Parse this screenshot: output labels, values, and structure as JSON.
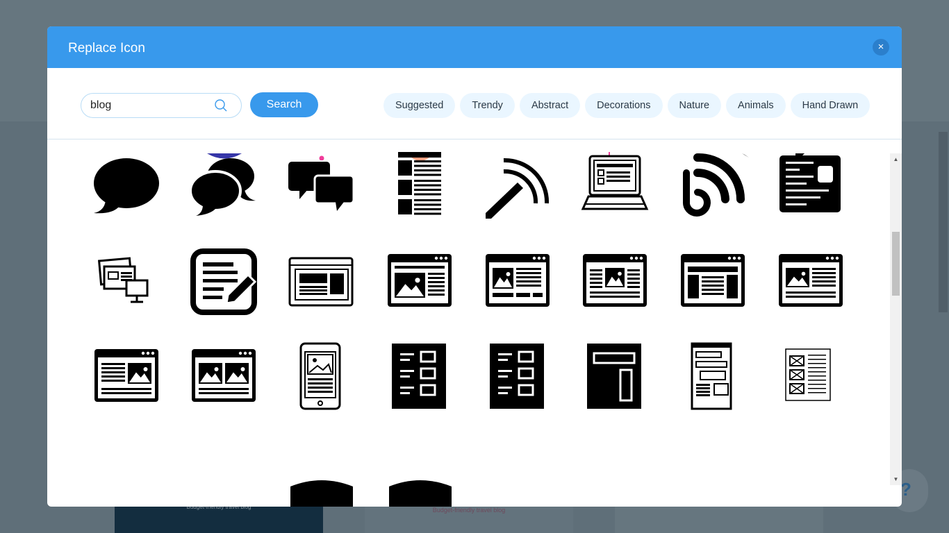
{
  "background": {
    "caption_1": "Budget-friendly travel blog",
    "caption_2": "Budget-friendly travel blog",
    "help": "?"
  },
  "modal": {
    "title": "Replace Icon",
    "close": "×",
    "search": {
      "value": "blog",
      "button": "Search"
    },
    "categories": [
      "Suggested",
      "Trendy",
      "Abstract",
      "Decorations",
      "Nature",
      "Animals",
      "Hand Drawn"
    ],
    "accent": "#3899ec",
    "icon_rows": [
      [
        "speech-bubble",
        "speech-bubbles",
        "chat-bubbles",
        "list-document",
        "rss-pencil",
        "laptop-blog",
        "blog-rss",
        "news-card"
      ],
      [
        "devices-windows",
        "edit-note",
        "browser-layout",
        "browser-image-sidebar",
        "browser-image-text",
        "browser-image-center",
        "browser-columns",
        "browser-image-left"
      ],
      [
        "browser-text-image",
        "browser-two-images",
        "mobile-image",
        "list-page",
        "list-page-2",
        "page-layout",
        "wireframe",
        "wireframe-outline"
      ]
    ]
  }
}
